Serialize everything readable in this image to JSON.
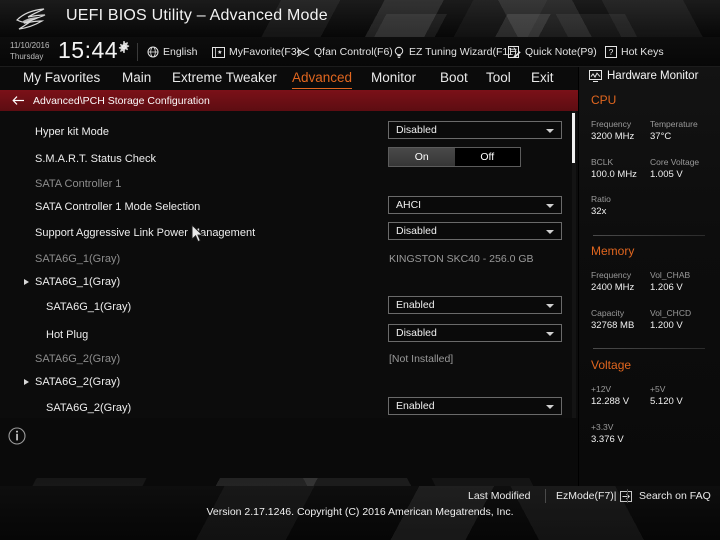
{
  "titlebar": {
    "logo_icon": "rog-eye-logo",
    "title": "UEFI BIOS Utility – Advanced Mode"
  },
  "infobar": {
    "date": "11/10/2016",
    "weekday": "Thursday",
    "time": "15:44",
    "gear_icon": "gear-icon",
    "tools": [
      {
        "label": "English",
        "icon": "globe-icon"
      },
      {
        "label": "MyFavorite(F3)",
        "icon": "star-book-icon"
      },
      {
        "label": "Qfan Control(F6)",
        "icon": "fan-icon"
      },
      {
        "label": "EZ Tuning Wizard(F11)",
        "icon": "lightbulb-icon"
      },
      {
        "label": "Quick Note(P9)",
        "icon": "note-icon"
      },
      {
        "label": "Hot Keys",
        "icon": "question-box-icon"
      }
    ]
  },
  "nav": {
    "items": [
      {
        "label": "My Favorites",
        "active": false
      },
      {
        "label": "Main",
        "active": false
      },
      {
        "label": "Extreme Tweaker",
        "active": false
      },
      {
        "label": "Advanced",
        "active": true
      },
      {
        "label": "Monitor",
        "active": false
      },
      {
        "label": "Boot",
        "active": false
      },
      {
        "label": "Tool",
        "active": false
      },
      {
        "label": "Exit",
        "active": false
      }
    ],
    "active_color": "#e1661f"
  },
  "breadcrumb": {
    "back_icon": "back-arrow-icon",
    "path": "Advanced\\PCH Storage Configuration"
  },
  "settings": [
    {
      "label": "Hyper kit Mode",
      "indent": 0,
      "dim": false,
      "control": "dropdown",
      "value": "Disabled"
    },
    {
      "label": "S.M.A.R.T. Status Check",
      "indent": 0,
      "dim": false,
      "control": "segment",
      "options": [
        "On",
        "Off"
      ],
      "selected": "On"
    },
    {
      "label": "SATA Controller 1",
      "indent": 0,
      "dim": true,
      "control": "none"
    },
    {
      "label": "SATA Controller 1 Mode Selection",
      "indent": 0,
      "dim": false,
      "control": "dropdown",
      "value": "AHCI"
    },
    {
      "label": "Support Aggressive Link Power Management",
      "indent": 0,
      "dim": false,
      "control": "dropdown",
      "value": "Disabled"
    },
    {
      "label": "SATA6G_1(Gray)",
      "indent": 1,
      "dim": true,
      "control": "text",
      "value": "KINGSTON SKC40 - 256.0 GB"
    },
    {
      "label": "SATA6G_1(Gray)",
      "indent": 0,
      "dim": false,
      "control": "none",
      "marker": "expand-arrow-icon"
    },
    {
      "label": "SATA6G_1(Gray)",
      "indent": 1,
      "dim": false,
      "control": "dropdown",
      "value": "Enabled"
    },
    {
      "label": "Hot Plug",
      "indent": 1,
      "dim": false,
      "control": "dropdown",
      "value": "Disabled"
    },
    {
      "label": "SATA6G_2(Gray)",
      "indent": 1,
      "dim": true,
      "control": "text",
      "value": "[Not Installed]"
    },
    {
      "label": "SATA6G_2(Gray)",
      "indent": 0,
      "dim": false,
      "control": "none",
      "marker": "expand-arrow-icon"
    },
    {
      "label": "SATA6G_2(Gray)",
      "indent": 1,
      "dim": false,
      "control": "dropdown",
      "value": "Enabled"
    }
  ],
  "hardware_monitor": {
    "title": "Hardware Monitor",
    "title_icon": "monitor-icon",
    "sections": [
      {
        "name": "CPU",
        "readings": [
          {
            "label": "Frequency",
            "value": "3200 MHz"
          },
          {
            "label": "Temperature",
            "value": "37°C"
          },
          {
            "label": "BCLK",
            "value": "100.0 MHz"
          },
          {
            "label": "Core Voltage",
            "value": "1.005 V"
          },
          {
            "label": "Ratio",
            "value": "32x"
          }
        ]
      },
      {
        "name": "Memory",
        "readings": [
          {
            "label": "Frequency",
            "value": "2400 MHz"
          },
          {
            "label": "Vol_CHAB",
            "value": "1.206 V"
          },
          {
            "label": "Capacity",
            "value": "32768 MB"
          },
          {
            "label": "Vol_CHCD",
            "value": "1.200 V"
          }
        ]
      },
      {
        "name": "Voltage",
        "readings": [
          {
            "label": "+12V",
            "value": "12.288 V"
          },
          {
            "label": "+5V",
            "value": "5.120 V"
          },
          {
            "label": "+3.3V",
            "value": "3.376 V"
          }
        ]
      }
    ],
    "header_color": "#e1661f"
  },
  "lowleft": {
    "info_icon": "info-icon"
  },
  "footer": {
    "items": [
      {
        "label": "Last Modified",
        "icon": ""
      },
      {
        "label": "EzMode(F7)|",
        "icon": "enter-arrow-icon"
      },
      {
        "label": "Search on FAQ",
        "icon": ""
      }
    ],
    "copyright": "Version 2.17.1246. Copyright (C) 2016 American Megatrends, Inc."
  },
  "cursor": {
    "icon": "mouse-pointer-icon"
  }
}
